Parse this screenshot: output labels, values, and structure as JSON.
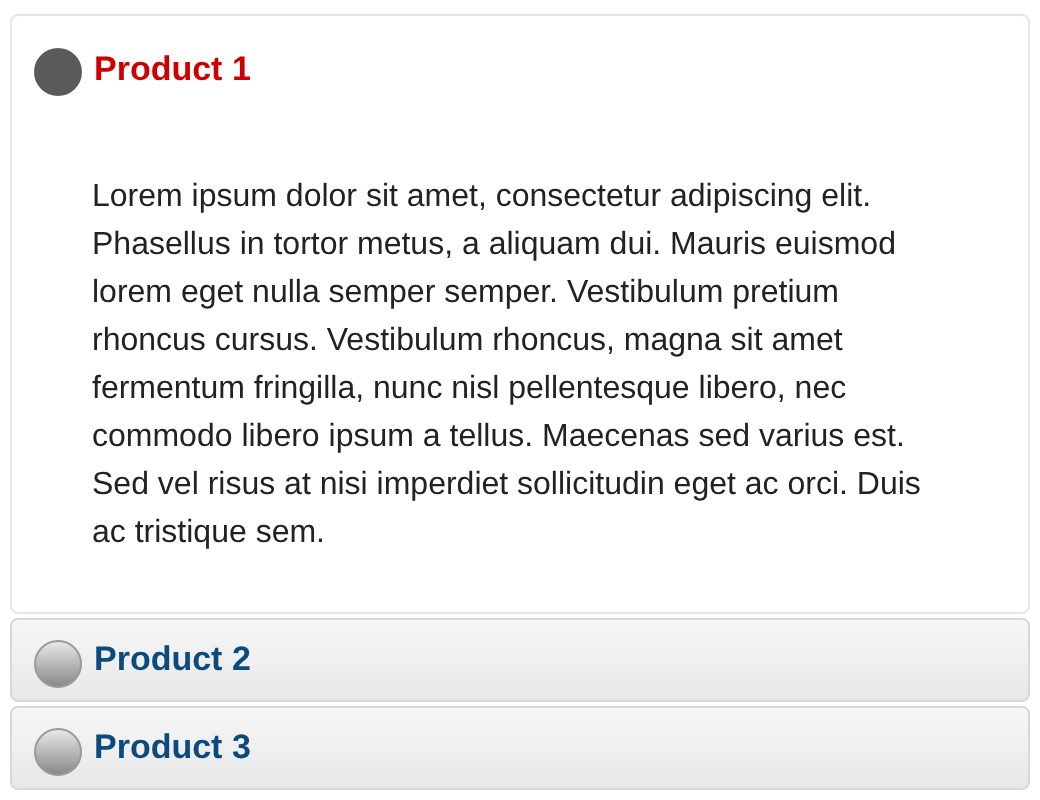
{
  "sections": [
    {
      "title": "Product 1",
      "expanded": true,
      "body": "Lorem ipsum dolor sit amet, consectetur adipiscing elit. Phasellus in tortor metus, a aliquam dui. Mauris euismod lorem eget nulla semper semper. Vestibulum pretium rhoncus cursus. Vestibulum rhoncus, magna sit amet fermentum fringilla, nunc nisl pellentesque libero, nec commodo libero ipsum a tellus. Maecenas sed varius est. Sed vel risus at nisi imperdiet sollicitudin eget ac orci. Duis ac tristique sem."
    },
    {
      "title": "Product 2",
      "expanded": false
    },
    {
      "title": "Product 3",
      "expanded": false
    }
  ]
}
